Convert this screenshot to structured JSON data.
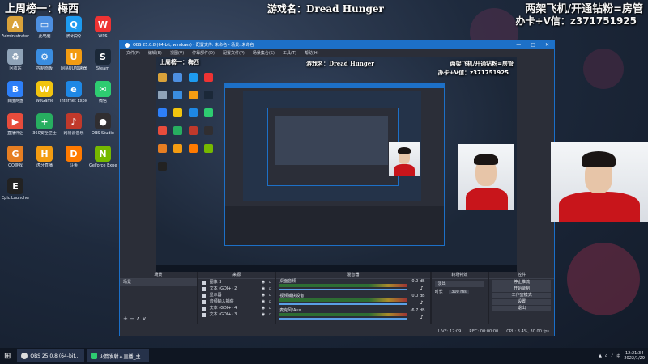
{
  "stream_overlay": {
    "top_left": "上周榜一：梅西",
    "game_title": "游戏名：Dread Hunger",
    "top_right_line1": "两架飞机/开通钻粉=房管",
    "top_right_line2": "办卡+V信：z371751925"
  },
  "desktop_icons": [
    {
      "label": "Administrator",
      "color": "#d9a23a",
      "glyph": "A"
    },
    {
      "label": "此电脑",
      "color": "#4d8fe0",
      "glyph": "▭"
    },
    {
      "label": "腾讯QQ",
      "color": "#1d9bf0",
      "glyph": "Q"
    },
    {
      "label": "WPS",
      "color": "#e33",
      "glyph": "W"
    },
    {
      "label": "回收站",
      "color": "#8fa3b8",
      "glyph": "♻"
    },
    {
      "label": "控制面板",
      "color": "#3a8de0",
      "glyph": "⚙"
    },
    {
      "label": "网易UU加速器",
      "color": "#f39c12",
      "glyph": "U"
    },
    {
      "label": "Steam",
      "color": "#1b2838",
      "glyph": "S"
    },
    {
      "label": "百度网盘",
      "color": "#2d7ff9",
      "glyph": "B"
    },
    {
      "label": "WeGame",
      "color": "#f1c40f",
      "glyph": "W"
    },
    {
      "label": "Internet Explorer",
      "color": "#1e88e5",
      "glyph": "e"
    },
    {
      "label": "微信",
      "color": "#2ecc71",
      "glyph": "✉"
    },
    {
      "label": "直播伴侣",
      "color": "#e74c3c",
      "glyph": "▶"
    },
    {
      "label": "360安全卫士",
      "color": "#27ae60",
      "glyph": "+"
    },
    {
      "label": "网易云音乐",
      "color": "#c0392b",
      "glyph": "♪"
    },
    {
      "label": "OBS Studio",
      "color": "#302e31",
      "glyph": "●"
    },
    {
      "label": "QQ游戏",
      "color": "#e67e22",
      "glyph": "G"
    },
    {
      "label": "虎牙直播",
      "color": "#f39c12",
      "glyph": "H"
    },
    {
      "label": "斗鱼",
      "color": "#ff7a00",
      "glyph": "D"
    },
    {
      "label": "GeForce Experience",
      "color": "#76b900",
      "glyph": "N"
    },
    {
      "label": "Epic Launcher",
      "color": "#222",
      "glyph": "E"
    }
  ],
  "obs": {
    "title": "OBS 25.0.8 (64-bit, windows) - 配置文件: 未命名 - 场景: 未命名",
    "menu": [
      "文件(F)",
      "编辑(E)",
      "视图(V)",
      "停靠部件(D)",
      "配置文件(P)",
      "场景集合(S)",
      "工具(T)",
      "帮助(H)"
    ],
    "docks": {
      "scenes": {
        "title": "场景",
        "items": [
          "场景"
        ]
      },
      "sources": {
        "title": "来源",
        "items": [
          "图像 3",
          "文本 (GDI+) 2",
          "显示器",
          "音频输入捕获",
          "文本 (GDI+) 4",
          "文本 (GDI+) 3"
        ]
      },
      "mixer": {
        "title": "混音器",
        "tracks": [
          {
            "name": "桌面音频",
            "db": "0.0 dB"
          },
          {
            "name": "视频捕获设备",
            "db": "0.0 dB"
          },
          {
            "name": "麦克风/Aux",
            "db": "-6.7 dB"
          }
        ]
      },
      "transitions": {
        "title": "转场特效",
        "type": "淡出",
        "duration_label": "时长",
        "duration": "300 ms"
      },
      "controls": {
        "title": "控件",
        "buttons": [
          "停止推流",
          "开始录制",
          "工作室模式",
          "设置",
          "退出"
        ]
      }
    },
    "status": {
      "live": "LIVE: 12:09",
      "rec": "REC: 00:00:00",
      "cpu": "CPU: 8.4%, 30.00 fps"
    }
  },
  "taskbar": {
    "items": [
      "OBS 25.0.8 (64-bit...",
      "火箭发射人直播_主..."
    ],
    "time": "12:21:34",
    "date": "2022/1/29",
    "lang": "中"
  }
}
